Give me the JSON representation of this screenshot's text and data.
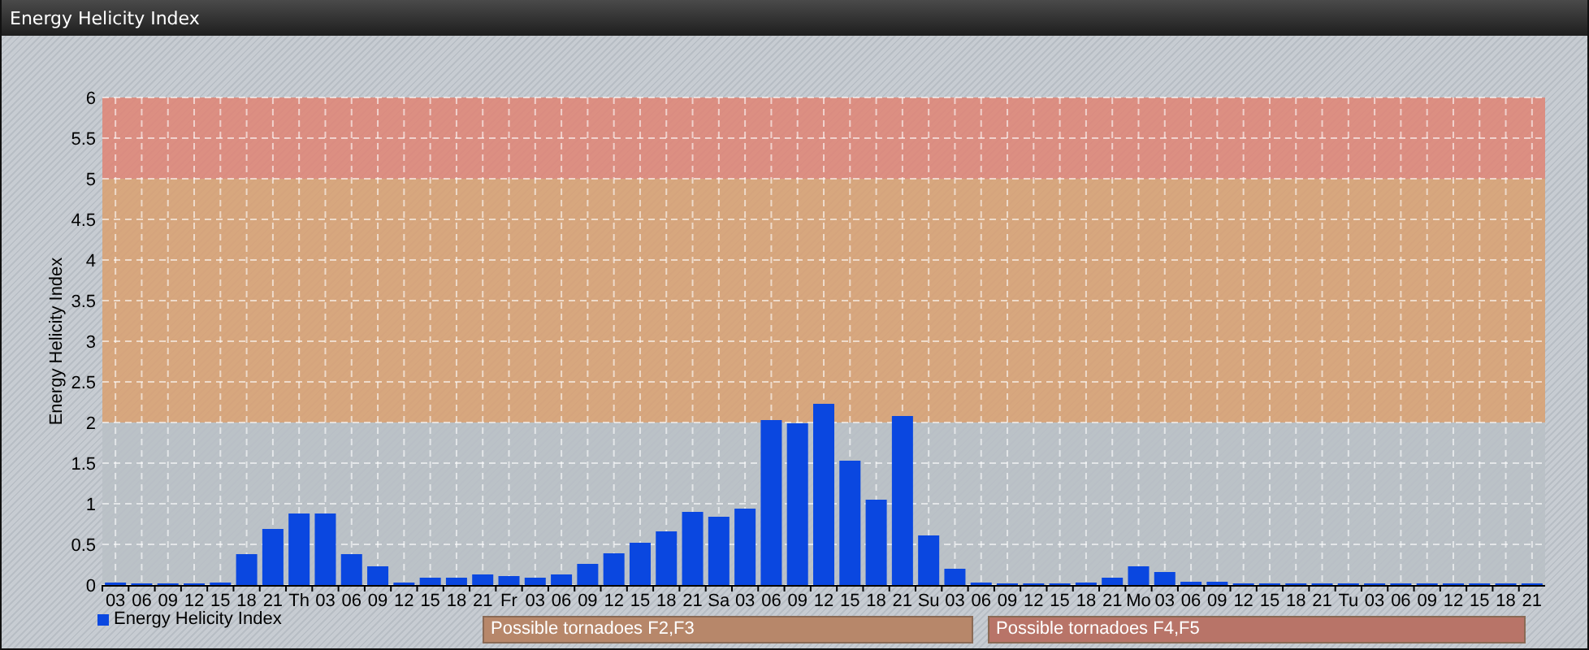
{
  "window": {
    "title": "Energy Helicity Index"
  },
  "chart_data": {
    "type": "bar",
    "ylabel": "Energy Helicity Index",
    "ylim": [
      0,
      6
    ],
    "yticks": [
      0,
      0.5,
      1,
      1.5,
      2,
      2.5,
      3,
      3.5,
      4,
      4.5,
      5,
      5.5,
      6
    ],
    "categories": [
      "03",
      "06",
      "09",
      "12",
      "15",
      "18",
      "21",
      "Th",
      "03",
      "06",
      "09",
      "12",
      "15",
      "18",
      "21",
      "Fr",
      "03",
      "06",
      "09",
      "12",
      "15",
      "18",
      "21",
      "Sa",
      "03",
      "06",
      "09",
      "12",
      "15",
      "18",
      "21",
      "Su",
      "03",
      "06",
      "09",
      "12",
      "15",
      "18",
      "21",
      "Mo",
      "03",
      "06",
      "09",
      "12",
      "15",
      "18",
      "21",
      "Tu",
      "03",
      "06",
      "09",
      "12",
      "15",
      "18",
      "21"
    ],
    "series": [
      {
        "name": "Energy Helicity Index",
        "color": "#0a47e0",
        "values": [
          0.03,
          0.02,
          0.02,
          0.02,
          0.03,
          0.38,
          0.69,
          0.88,
          0.88,
          0.38,
          0.23,
          0.03,
          0.09,
          0.09,
          0.13,
          0.11,
          0.09,
          0.13,
          0.26,
          0.39,
          0.52,
          0.66,
          0.9,
          0.84,
          0.94,
          2.03,
          1.99,
          2.23,
          1.53,
          1.05,
          2.08,
          0.61,
          0.2,
          0.03,
          0.02,
          0.02,
          0.02,
          0.03,
          0.09,
          0.23,
          0.16,
          0.04,
          0.04,
          0.02,
          0.02,
          0.02,
          0.02,
          0.02,
          0.02,
          0.02,
          0.02,
          0.02,
          0.02,
          0.02,
          0.02
        ]
      }
    ],
    "grid": true,
    "bands": [
      {
        "axis": "y",
        "from": 0,
        "to": 2,
        "color": "#b9bfc6"
      },
      {
        "axis": "y",
        "from": 2,
        "to": 5,
        "color": "#d9a070"
      },
      {
        "axis": "y",
        "from": 5,
        "to": 6,
        "color": "#df8474"
      }
    ]
  },
  "alerts": [
    {
      "label": "Possible tornadoes F2,F3",
      "color": "#b7876a"
    },
    {
      "label": "Possible tornadoes F4,F5",
      "color": "#b87468"
    }
  ]
}
